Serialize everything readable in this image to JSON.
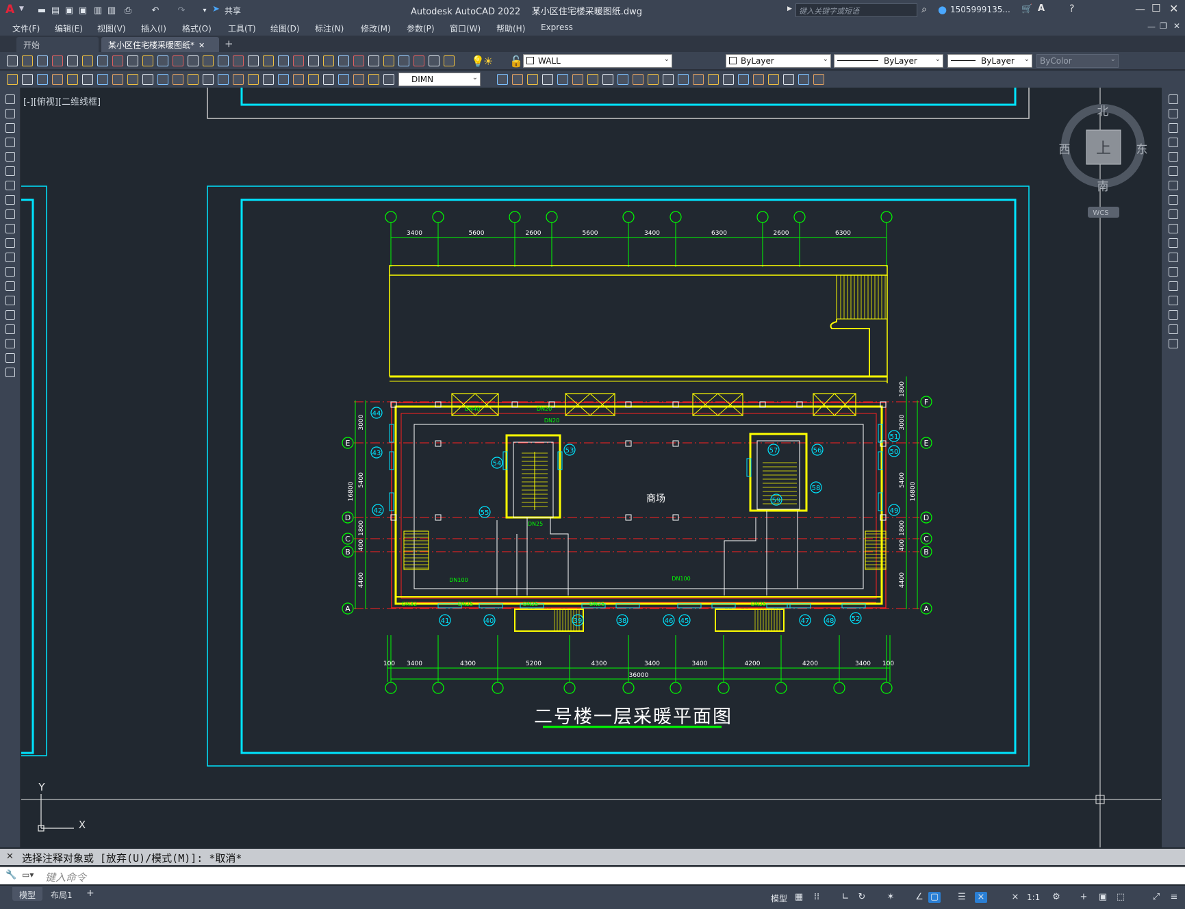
{
  "titlebar": {
    "app_title": "Autodesk AutoCAD 2022",
    "file_name": "某小区住宅楼采暖图纸.dwg",
    "share_label": "共享",
    "search_placeholder": "键入关键字或短语",
    "user_name": "1505999135..."
  },
  "menu": [
    "文件(F)",
    "编辑(E)",
    "视图(V)",
    "插入(I)",
    "格式(O)",
    "工具(T)",
    "绘图(D)",
    "标注(N)",
    "修改(M)",
    "参数(P)",
    "窗口(W)",
    "帮助(H)",
    "Express"
  ],
  "tabs": {
    "start": "开始",
    "active": "某小区住宅楼采暖图纸*",
    "add": "+"
  },
  "toolbar": {
    "layer": "WALL",
    "color": "ByLayer",
    "linetype": "ByLayer",
    "lineweight": "ByLayer",
    "plotstyle": "ByColor",
    "dimstyle": "DIMN"
  },
  "viewport": {
    "view_label": "[-][俯视][二维线框]",
    "viewcube": {
      "north": "北",
      "south": "南",
      "west": "西",
      "east": "东",
      "face": "上",
      "wcs": "WCS"
    },
    "ucs": {
      "x": "X",
      "y": "Y"
    }
  },
  "drawing": {
    "title": "二号楼一层采暖平面图",
    "room_label": "商场",
    "top_dims": [
      "3400",
      "5600",
      "2600",
      "5600",
      "3400",
      "6300",
      "2600",
      "6300"
    ],
    "bottom_dims": [
      "100",
      "3400",
      "4300",
      "5200",
      "4300",
      "3400",
      "3400",
      "4200",
      "4200",
      "3400",
      "100"
    ],
    "total_dim": "36000",
    "left_dims": [
      "3000",
      "5400",
      "1800",
      "400",
      "4400"
    ],
    "left_total": "16800",
    "right_dims": [
      "1800",
      "3000",
      "5400",
      "1800",
      "400",
      "4400"
    ],
    "right_total": "16800",
    "row_axes": [
      "F",
      "E",
      "D",
      "C",
      "B",
      "A"
    ],
    "radiator_tags": [
      "44",
      "43",
      "42",
      "41",
      "40",
      "39",
      "38",
      "46",
      "45",
      "47",
      "48",
      "51",
      "50",
      "49",
      "52",
      "53",
      "54",
      "55",
      "56",
      "57",
      "58",
      "59"
    ],
    "pipe_labels": [
      "DN40",
      "DN20",
      "DN20",
      "DN25",
      "DN100",
      "DN100",
      "DN32",
      "DN25",
      "DN25",
      "DN25",
      "DN25"
    ]
  },
  "command": {
    "history": "选择注释对象或 [放弃(U)/模式(M)]: *取消*",
    "placeholder": "键入命令"
  },
  "status": {
    "model": "模型",
    "layout1": "布局1",
    "add": "+",
    "space": "模型",
    "scale": "1:1"
  },
  "colors": {
    "titlebar": "#3b4453",
    "canvas": "#212830",
    "frame": "#00e5ff",
    "grid": "#00ff00",
    "wall": "#ffff00",
    "pipe_red": "#ff2020",
    "white": "#ffffff"
  }
}
